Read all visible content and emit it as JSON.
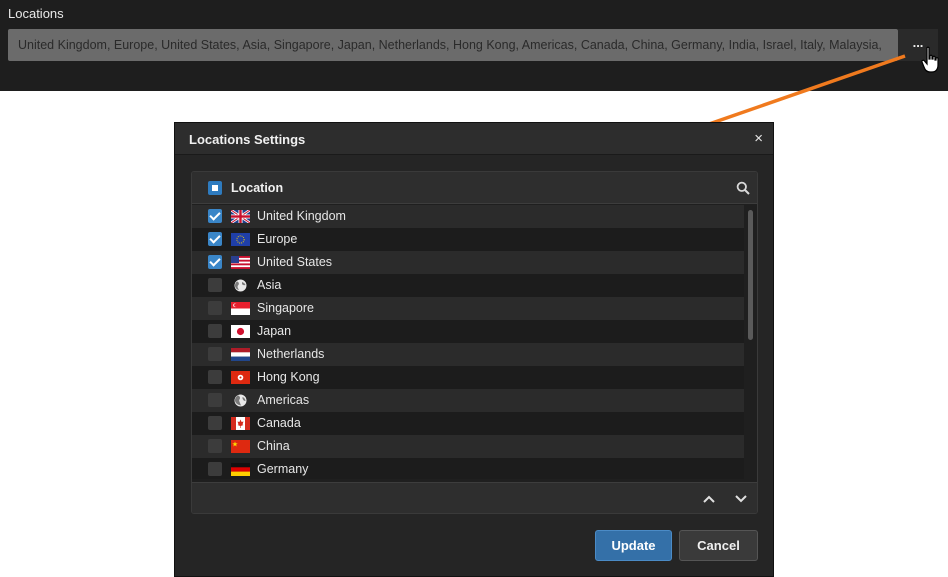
{
  "top": {
    "label": "Locations",
    "field_value": "United Kingdom, Europe, United States, Asia, Singapore, Japan, Netherlands, Hong Kong, Americas, Canada, China, Germany, India, Israel, Italy, Malaysia,",
    "more_label": "..."
  },
  "dialog": {
    "title": "Locations Settings",
    "close_label": "×",
    "column_header": "Location",
    "header_checkbox": "partial",
    "items": [
      {
        "label": "United Kingdom",
        "checked": true,
        "flag": "uk-flag-icon"
      },
      {
        "label": "Europe",
        "checked": true,
        "flag": "eu-flag-icon"
      },
      {
        "label": "United States",
        "checked": true,
        "flag": "us-flag-icon"
      },
      {
        "label": "Asia",
        "checked": false,
        "flag": "globe-icon"
      },
      {
        "label": "Singapore",
        "checked": false,
        "flag": "sg-flag-icon"
      },
      {
        "label": "Japan",
        "checked": false,
        "flag": "jp-flag-icon"
      },
      {
        "label": "Netherlands",
        "checked": false,
        "flag": "nl-flag-icon"
      },
      {
        "label": "Hong Kong",
        "checked": false,
        "flag": "hk-flag-icon"
      },
      {
        "label": "Americas",
        "checked": false,
        "flag": "globe-icon"
      },
      {
        "label": "Canada",
        "checked": false,
        "flag": "ca-flag-icon"
      },
      {
        "label": "China",
        "checked": false,
        "flag": "cn-flag-icon"
      },
      {
        "label": "Germany",
        "checked": false,
        "flag": "de-flag-icon"
      }
    ],
    "update_label": "Update",
    "cancel_label": "Cancel"
  },
  "colors": {
    "accent": "#3470a8",
    "annotation_arrow": "#f07a1e"
  }
}
